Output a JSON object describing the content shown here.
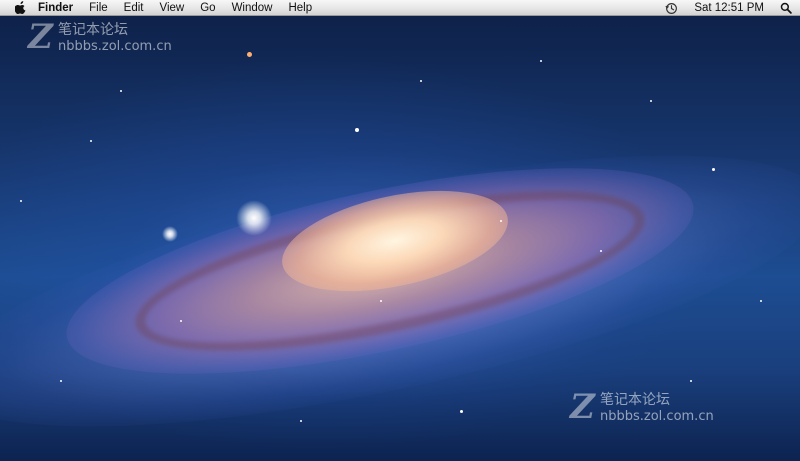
{
  "menubar": {
    "apple_icon": "apple-logo-icon",
    "app_name": "Finder",
    "menus": [
      "File",
      "Edit",
      "View",
      "Go",
      "Window",
      "Help"
    ],
    "time_machine_icon": "time-machine-clock-icon",
    "clock": "Sat 12:51 PM",
    "spotlight_icon": "spotlight-search-icon"
  },
  "watermark_top": {
    "letter": "Z",
    "text": "笔记本论坛",
    "domain": "nbbbs.zol.com.cn"
  },
  "watermark_bottom": {
    "letter": "Z",
    "text": "笔记本论坛",
    "domain": "nbbbs.zol.com.cn"
  },
  "desktop": {
    "wallpaper": "andromeda-galaxy",
    "colors": {
      "space_dark": "#0d1f45",
      "space_blue": "#1d4d92",
      "core": "#ffe8d0"
    }
  }
}
